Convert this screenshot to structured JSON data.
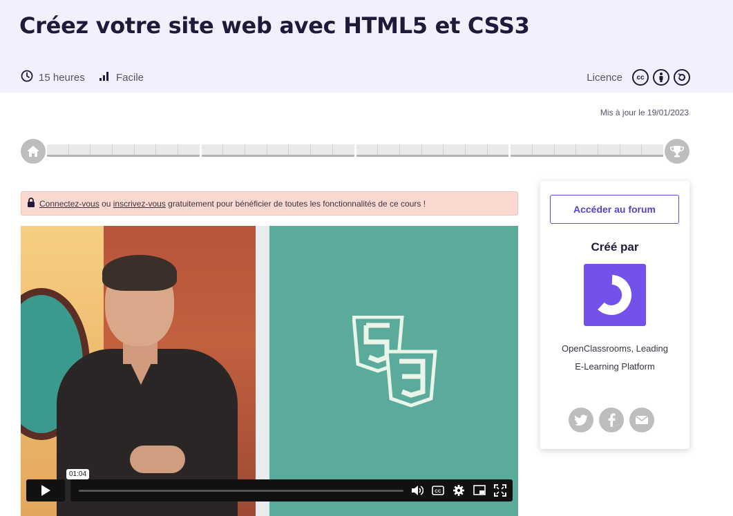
{
  "course": {
    "title": "Créez votre site web avec HTML5 et CSS3",
    "duration": "15 heures",
    "level": "Facile",
    "licence_label": "Licence",
    "licence_icons": [
      "cc-icon",
      "by-icon",
      "sa-icon"
    ],
    "updated": "Mis à jour le 19/01/2023"
  },
  "progress": {
    "sections": 4,
    "steps_per_section": 7
  },
  "notice": {
    "login_link": "Connectez-vous",
    "or": "ou",
    "signup_link": "inscrivez-vous",
    "rest": "gratuitement pour bénéficier de toutes les fonctionnalités de ce cours !"
  },
  "video": {
    "time_tooltip": "01:04"
  },
  "sidebar": {
    "forum_button": "Accéder au forum",
    "created_by": "Créé par",
    "creator_line1": "OpenClassrooms, Leading",
    "creator_line2": "E-Learning Platform",
    "share": [
      "twitter-icon",
      "facebook-icon",
      "email-icon"
    ]
  },
  "colors": {
    "hero_bg": "#f2f0fc",
    "accent": "#7451eb",
    "notice_bg": "#fbd8d0",
    "video_right_bg": "#5aab9b"
  }
}
